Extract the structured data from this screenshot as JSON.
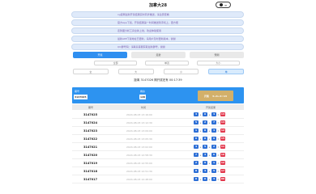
{
  "app": {
    "title": "加拿大28",
    "button_label": "≡"
  },
  "notices": [
    "ng官网最新开奖结果实时同步推送，请注意查看",
    "官方App下载，开奖结果第一时间推送到手机上，更方便",
    "走势图分析工具全新上线，欢迎体验使用",
    "最新APP下载地址已更新，请用户及时更新版本，谢谢",
    "QQ群号码：请联系客服获取最新群号，谢谢"
  ],
  "tabs": [
    {
      "label": "开奖",
      "active": true
    },
    {
      "label": "走势",
      "active": false
    },
    {
      "label": "预测",
      "active": false
    }
  ],
  "subfilters": [
    "全部",
    "单双",
    "大小"
  ],
  "filters": [
    {
      "label": "全",
      "active": false
    },
    {
      "label": "大",
      "active": false
    },
    {
      "label": "小",
      "active": false
    },
    {
      "label": "单",
      "active": true
    }
  ],
  "summary": "距离 3147026 期开奖还有 00:17:39",
  "banner": {
    "issue_caption": "期号",
    "issue": "3147025",
    "count_caption": "剩余",
    "count": "120",
    "balls_label": "开奖",
    "balls_value": "3+6+4=13"
  },
  "table": {
    "headers": [
      "期号",
      "时间",
      "开奖结果"
    ],
    "rows": [
      {
        "issue": "3147025",
        "time": "2024-08-03 13:16:00",
        "a": "3",
        "b": "6",
        "c": "4",
        "sum": "13"
      },
      {
        "issue": "3147024",
        "time": "2024-08-03 13:12:30",
        "a": "5",
        "b": "2",
        "c": "7",
        "sum": "14"
      },
      {
        "issue": "3147023",
        "time": "2024-08-03 13:09:00",
        "a": "1",
        "b": "8",
        "c": "3",
        "sum": "12"
      },
      {
        "issue": "3147022",
        "time": "2024-08-03 13:05:30",
        "a": "6",
        "b": "0",
        "c": "9",
        "sum": "15"
      },
      {
        "issue": "3147021",
        "time": "2024-08-03 13:02:00",
        "a": "4",
        "b": "5",
        "c": "2",
        "sum": "11"
      },
      {
        "issue": "3147020",
        "time": "2024-08-03 12:58:30",
        "a": "7",
        "b": "3",
        "c": "6",
        "sum": "16"
      },
      {
        "issue": "3147019",
        "time": "2024-08-03 12:55:00",
        "a": "2",
        "b": "9",
        "c": "1",
        "sum": "12"
      },
      {
        "issue": "3147018",
        "time": "2024-08-03 12:51:30",
        "a": "8",
        "b": "4",
        "c": "5",
        "sum": "17"
      },
      {
        "issue": "3147017",
        "time": "2024-08-03 12:48:00",
        "a": "0",
        "b": "6",
        "c": "3",
        "sum": "09"
      }
    ]
  },
  "colors": {
    "accent": "#2d93f0",
    "ball": "#2d6fd6",
    "sum_ball": "#e2384d",
    "gold": "#d3b06a"
  }
}
